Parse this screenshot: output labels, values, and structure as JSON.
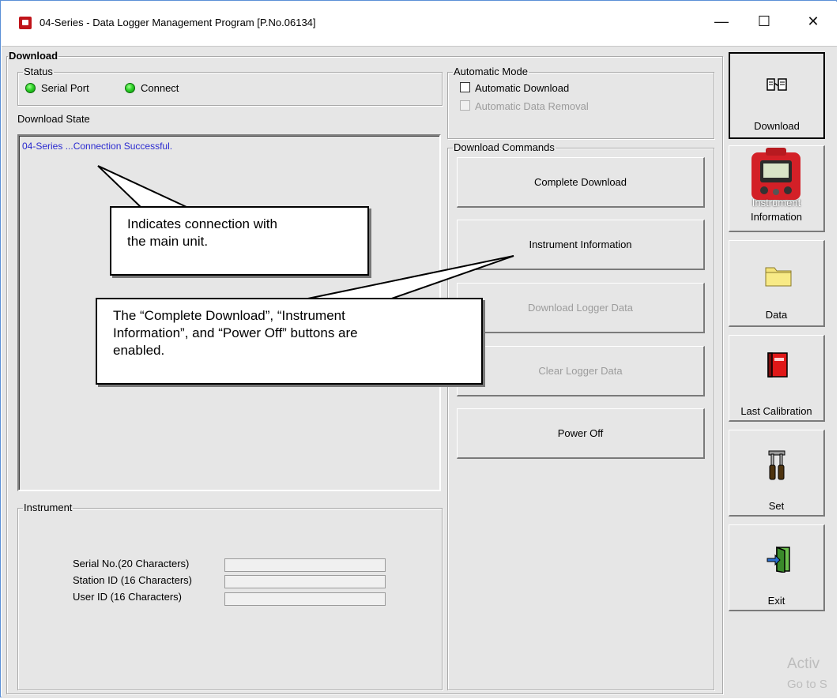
{
  "window": {
    "title": "04-Series - Data Logger Management Program [P.No.06134]",
    "controls": {
      "minimize": "—",
      "maximize": "☐",
      "close": "✕"
    }
  },
  "download_group": {
    "label": "Download",
    "status": {
      "label": "Status",
      "serial_port": "Serial Port",
      "connect": "Connect"
    },
    "download_state": {
      "label": "Download State",
      "message": "04-Series ...Connection Successful."
    }
  },
  "automatic_mode": {
    "label": "Automatic Mode",
    "automatic_download": "Automatic Download",
    "automatic_data_removal": "Automatic Data Removal"
  },
  "download_commands": {
    "label": "Download Commands",
    "buttons": {
      "complete_download": "Complete Download",
      "instrument_information": "Instrument Information",
      "download_logger_data": "Download Logger Data",
      "clear_logger_data": "Clear Logger Data",
      "power_off": "Power Off"
    }
  },
  "instrument": {
    "label": "Instrument",
    "serial_no_label": "Serial No.(20 Characters)",
    "serial_no_value": "",
    "station_id_label": "Station ID (16 Characters)",
    "station_id_value": "",
    "user_id_label": "User ID (16 Characters)",
    "user_id_value": ""
  },
  "sidebar": {
    "download": "Download",
    "instrument_information_line1": "Instrument",
    "instrument_information_line2": "Information",
    "data": "Data",
    "last_calibration": "Last Calibration",
    "set": "Set",
    "exit": "Exit"
  },
  "callouts": {
    "connection_line1": "Indicates connection with",
    "connection_line2": "the main unit.",
    "buttons_line1": "The “Complete Download”, “Instrument",
    "buttons_line2": "Information”, and “Power Off” buttons are",
    "buttons_line3": "enabled."
  },
  "watermark": {
    "line1": "Activ",
    "line2": "Go to S"
  }
}
